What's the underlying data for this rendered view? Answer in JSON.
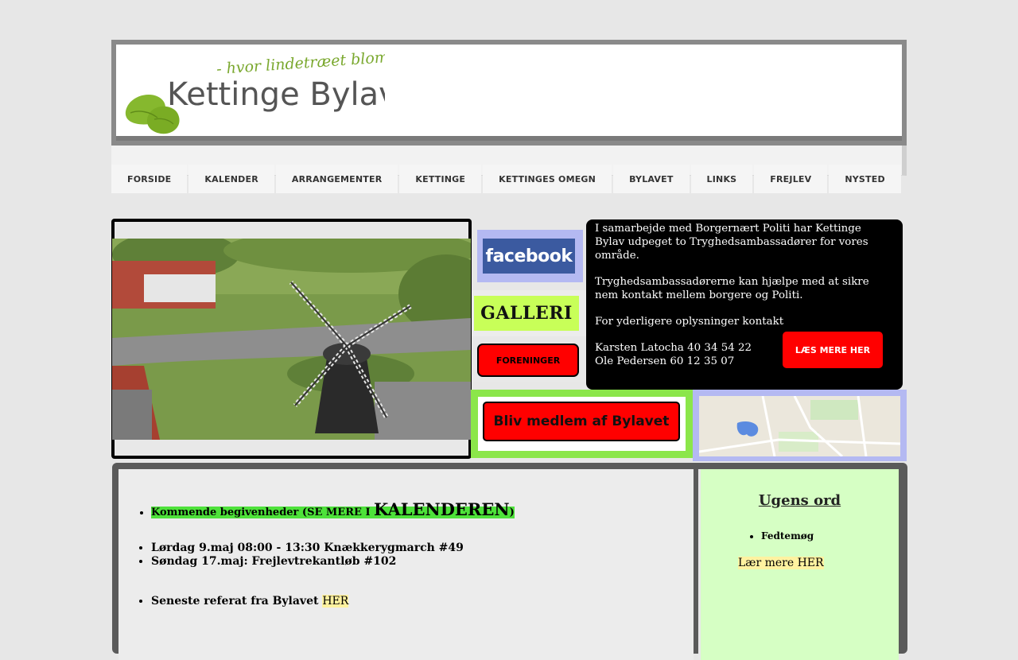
{
  "header": {
    "logo_tagline": "- hvor lindetræet blomstrer",
    "logo_title": "Kettinge Bylav"
  },
  "nav": {
    "items": [
      "FORSIDE",
      "KALENDER",
      "ARRANGEMENTER",
      "KETTINGE",
      "KETTINGES OMEGN",
      "BYLAVET",
      "LINKS",
      "FREJLEV",
      "NYSTED"
    ]
  },
  "sidebar": {
    "facebook_label": "facebook",
    "galleri_label": "GALLERI",
    "foreninger_label": "FORENINGER"
  },
  "info": {
    "p1": "I samarbejde med Borgernært Politi har Kettinge Bylav udpeget to Tryghedsambassadører for vores område.",
    "p2": "Tryghedsambassadørerne kan  hjælpe med at sikre nem kontakt mellem borgere og Politi.",
    "p3": "For yderligere oplysninger kontakt",
    "contact1": "Karsten Latocha 40 34 54 22",
    "contact2": "Ole Pedersen 60 12 35 07",
    "button_label": "LÆS MERE HER"
  },
  "membership": {
    "button_label": "Bliv medlem af Bylavet"
  },
  "events": {
    "heading_prefix": "Kommende begivenheder (SE MERE I ",
    "heading_link": "KALENDEREN",
    "heading_suffix": ")",
    "items": [
      "Lørdag 9.maj 08:00 - 13:30 Knækkerygmarch #49",
      "Søndag 17.maj: Frejlevtrekantløb #102"
    ],
    "referat_text": "Seneste referat fra Bylavet ",
    "referat_link": "HER"
  },
  "ugens_ord": {
    "title": "Ugens ord",
    "items": [
      "Fedtemøg"
    ],
    "laer_mere": "Lær mere HER"
  },
  "colors": {
    "accent_red": "#ff0000",
    "accent_green": "#8be64a",
    "facebook_blue": "#3b5aa0",
    "box_blue": "#b4b9f2"
  }
}
